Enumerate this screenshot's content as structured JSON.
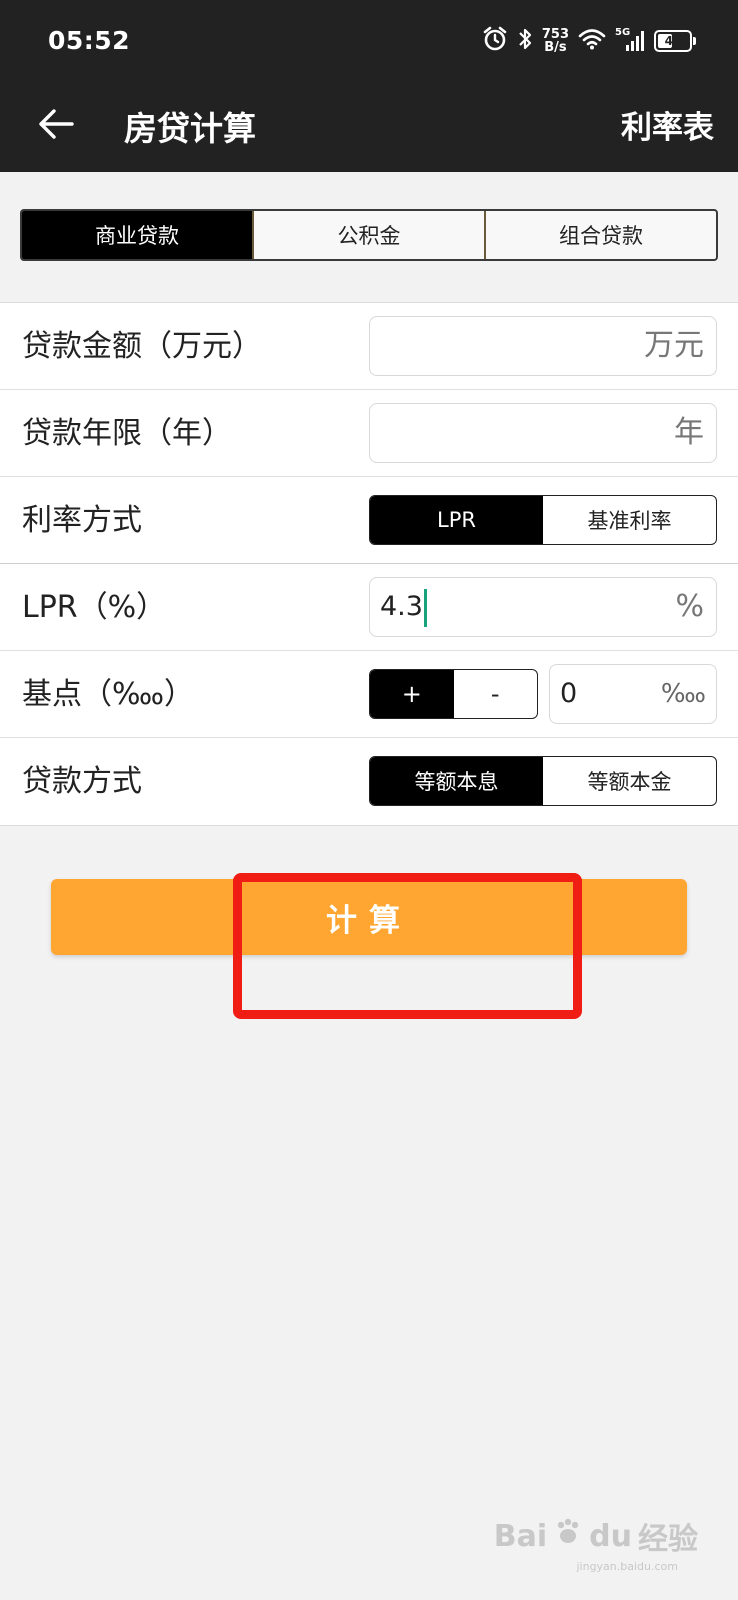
{
  "status_bar": {
    "time": "05:52",
    "net_speed_value": "753",
    "net_speed_unit": "B/s",
    "network": "5G",
    "battery": "42",
    "battery_level": 0.42,
    "icons": [
      "alarm-icon",
      "bluetooth-icon",
      "wifi-icon",
      "cellular-signal-icon",
      "battery-icon"
    ]
  },
  "app_bar": {
    "title": "房贷计算",
    "action_label": "利率表",
    "back_icon": "arrow-left-icon"
  },
  "loan_type_tabs": {
    "items": [
      {
        "label": "商业贷款",
        "active": true
      },
      {
        "label": "公积金",
        "active": false
      },
      {
        "label": "组合贷款",
        "active": false
      }
    ]
  },
  "form": {
    "amount": {
      "label": "贷款金额（万元）",
      "value": "",
      "suffix": "万元"
    },
    "term": {
      "label": "贷款年限（年）",
      "value": "",
      "suffix": "年"
    },
    "rate_mode": {
      "label": "利率方式",
      "options": [
        {
          "label": "LPR",
          "active": true
        },
        {
          "label": "基准利率",
          "active": false
        }
      ]
    },
    "lpr": {
      "label": "LPR（%）",
      "value": "4.3",
      "suffix": "%"
    },
    "basis_points": {
      "label": "基点（‱）",
      "plus": "+",
      "minus": "-",
      "value": "0",
      "suffix": "‱"
    },
    "repay_mode": {
      "label": "贷款方式",
      "options": [
        {
          "label": "等额本息",
          "active": true
        },
        {
          "label": "等额本金",
          "active": false
        }
      ]
    }
  },
  "calculate_button": {
    "label": "计算"
  },
  "colors": {
    "header_bg": "#222222",
    "accent_orange": "#ffa532",
    "highlight_red": "#f01d14",
    "active_segment": "#000000"
  },
  "watermark": {
    "brand": "Bai",
    "brand2": "du",
    "text": "经验",
    "sub": "jingyan.baidu.com"
  }
}
